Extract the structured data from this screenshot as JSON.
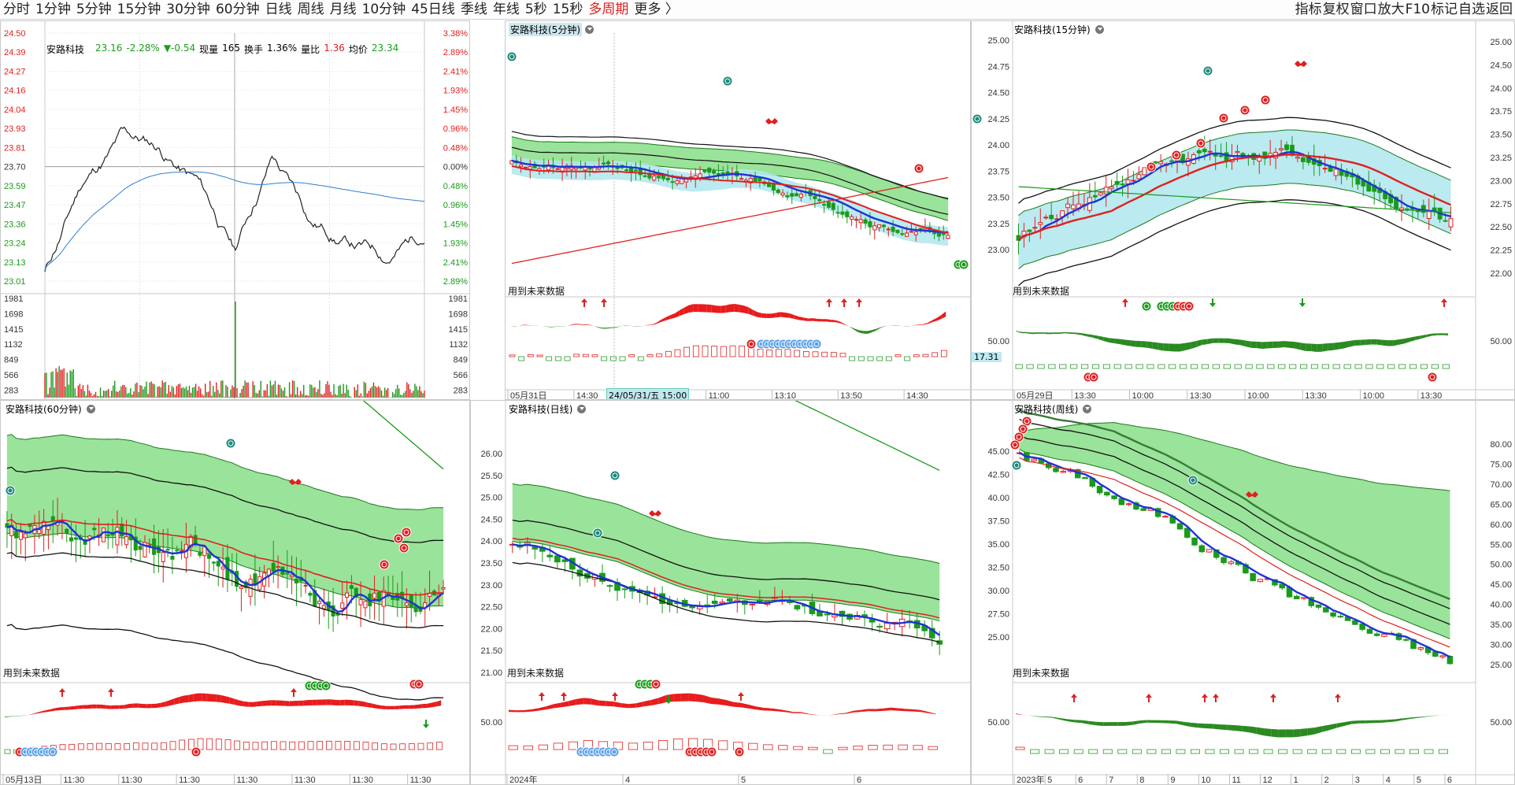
{
  "toolbar": {
    "periods": [
      "分时",
      "1分钟",
      "5分钟",
      "15分钟",
      "30分钟",
      "60分钟",
      "日线",
      "周线",
      "月线",
      "10分钟",
      "45日线",
      "季线",
      "年线",
      "5秒",
      "15秒",
      "多周期",
      "更多 〉"
    ],
    "active_index": 15,
    "right_items": [
      "指标",
      "复权",
      "窗口",
      "放大",
      "F10",
      "标记",
      "自选",
      "返回"
    ]
  },
  "intraday": {
    "quote": {
      "name": "安路科技",
      "price": "23.16",
      "change_pct": "-2.28%",
      "change": "▼-0.54",
      "volume_label": "现量",
      "volume": "165",
      "turnover_label": "换手",
      "turnover": "1.36%",
      "ratio_label": "量比",
      "ratio": "1.36",
      "avg_label": "均价",
      "avg": "23.34"
    },
    "price_ticks": [
      "24.50",
      "24.39",
      "24.27",
      "24.16",
      "24.04",
      "23.93",
      "23.81",
      "23.70",
      "23.59",
      "23.47",
      "23.36",
      "23.24",
      "23.13",
      "23.01"
    ],
    "pct_ticks": [
      "3.38%",
      "2.89%",
      "2.41%",
      "1.93%",
      "1.45%",
      "0.96%",
      "0.48%",
      "0.00%",
      "0.48%",
      "0.96%",
      "1.45%",
      "1.93%",
      "2.41%",
      "2.89%"
    ],
    "vol_ticks": [
      "1981",
      "1698",
      "1415",
      "1132",
      "849",
      "566",
      "283"
    ]
  },
  "panels": {
    "p5m": {
      "title": "安路科技(5分钟)",
      "future": "用到未来数据",
      "indicator_tick": "",
      "date_marker": "24/05/31/五 15:00",
      "axis": [
        "05月31日",
        "14:30",
        "10:20",
        "11:00",
        "13:10",
        "13:50",
        "14:30"
      ],
      "price_ticks": []
    },
    "p15m": {
      "title": "安路科技(15分钟)",
      "future": "用到未来数据",
      "indicator_tick": "50.00",
      "value_box": "17.31",
      "price_ticks": [
        "25.00",
        "24.75",
        "24.50",
        "24.25",
        "24.00",
        "23.75",
        "23.50",
        "23.25",
        "23.00"
      ],
      "right_ticks": [
        "25.00",
        "24.50",
        "24.00",
        "23.75",
        "23.50",
        "23.25",
        "23.00",
        "22.75",
        "22.50",
        "22.25",
        "22.00"
      ],
      "right_ind_tick": "50.00",
      "axis": [
        "05月29日",
        "13:30",
        "10:00",
        "13:30",
        "10:00",
        "13:30",
        "10:00",
        "13:30"
      ]
    },
    "p60m": {
      "title": "安路科技(60分钟)",
      "future": "用到未来数据",
      "axis": [
        "05月13日",
        "11:30",
        "11:30",
        "11:30",
        "11:30",
        "11:30",
        "11:30",
        "11:30"
      ]
    },
    "pday": {
      "title": "安路科技(日线)",
      "future": "用到未来数据",
      "indicator_tick": "50.00",
      "price_ticks": [
        "26.00",
        "25.50",
        "25.00",
        "24.50",
        "24.00",
        "23.50",
        "23.00",
        "22.50",
        "22.00",
        "21.50",
        "21.00"
      ],
      "axis": [
        "2024年",
        "4",
        "5",
        "6"
      ]
    },
    "pweek": {
      "title": "安路科技(周线)",
      "future": "用到未来数据",
      "indicator_tick": "50.00",
      "price_ticks": [
        "45.00",
        "42.50",
        "40.00",
        "37.50",
        "35.00",
        "32.50",
        "30.00",
        "27.50",
        "25.00"
      ],
      "right_ticks": [
        "80.00",
        "75.00",
        "70.00",
        "65.00",
        "60.00",
        "55.00",
        "50.00",
        "45.00",
        "40.00",
        "35.00",
        "30.00",
        "25.00"
      ],
      "right_ind_tick": "50.00",
      "axis": [
        "2023年",
        "5",
        "6",
        "7",
        "8",
        "9",
        "10",
        "11",
        "12",
        "1",
        "2",
        "3",
        "4",
        "5",
        "6"
      ]
    }
  },
  "colors": {
    "up": "#e02020",
    "down": "#1a9a1a",
    "ma_blue": "#1d33d6",
    "band_fill": "#8ee08e",
    "band_cyan": "#b4e8ee",
    "grid": "#e3e3e3"
  }
}
